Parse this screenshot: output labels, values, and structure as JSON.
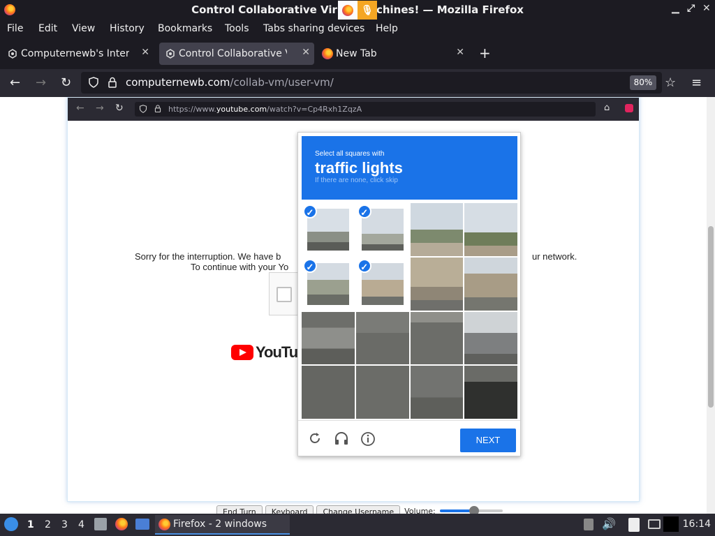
{
  "window": {
    "title": "Control Collaborative Virtual Machines! — Mozilla Firefox",
    "title_visible": "Control Collaborative Vir",
    "title_tail": "chines! — Mozilla Firefox",
    "controls": [
      "_",
      "⤢",
      "✕"
    ]
  },
  "menu": [
    "File",
    "Edit",
    "View",
    "History",
    "Bookmarks",
    "Tools",
    "Tabs sharing devices",
    "Help"
  ],
  "tabs": [
    {
      "label": "Computernewb's Internet",
      "active": false
    },
    {
      "label": "Control Collaborative Virt",
      "active": true
    },
    {
      "label": "New Tab",
      "active": false
    }
  ],
  "new_tab_label": "+",
  "nav": {
    "url_host": "computernewb.com",
    "url_path": "/collab-vm/user-vm/",
    "zoom": "80%"
  },
  "vm": {
    "url_prefix": "https://www.",
    "url_host": "youtube.com",
    "url_path": "/watch?v=Cp4Rxh1ZqzA",
    "sorry_line1": "Sorry for the interruption. We have b",
    "sorry_line1_end": "ur network.",
    "sorry_line2": "To continue with your Yo",
    "youtube_text": "YouTube"
  },
  "captcha": {
    "instruction": "Select all squares with",
    "target": "traffic lights",
    "hint": "If there are none, click skip",
    "selected_tiles": [
      0,
      1,
      4,
      5
    ],
    "next_label": "NEXT",
    "icons": [
      "reload-icon",
      "headphones-icon",
      "info-icon"
    ]
  },
  "vm_controls": [
    "End Turn",
    "Keyboard",
    "Change Username",
    "Volume:"
  ],
  "volume_level": 0.55,
  "taskbar": {
    "workspaces": [
      "1",
      "2",
      "3",
      "4"
    ],
    "active_workspace": "1",
    "task_label": "Firefox - 2 windows",
    "clock": "16:14"
  }
}
